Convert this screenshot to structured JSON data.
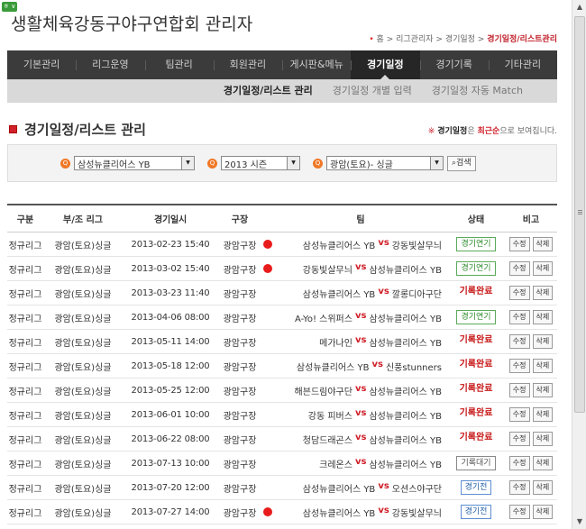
{
  "badge": "ㅎ ∨",
  "site_title": "생활체육강동구야구연합회 관리자",
  "breadcrumb": {
    "home": "홈",
    "path": "리그관리자 > 경기일정 >",
    "current": "경기일정/리스트관리"
  },
  "gnb": [
    {
      "label": "기본관리",
      "active": false
    },
    {
      "label": "리그운영",
      "active": false
    },
    {
      "label": "팀관리",
      "active": false
    },
    {
      "label": "회원관리",
      "active": false
    },
    {
      "label": "게시판&메뉴",
      "active": false
    },
    {
      "label": "경기일정",
      "active": true
    },
    {
      "label": "경기기록",
      "active": false
    },
    {
      "label": "기타관리",
      "active": false
    }
  ],
  "lnb": [
    {
      "label": "경기일정/리스트 관리",
      "active": true
    },
    {
      "label": "경기일정 개별 입력",
      "active": false
    },
    {
      "label": "경기일정 자동 Match",
      "active": false
    }
  ],
  "page_title": "경기일정/리스트 관리",
  "notice": {
    "mark": "※",
    "bold": "경기일정",
    "text1": "은",
    "red": "최근순",
    "text2": "으로 보여집니다."
  },
  "filter": {
    "team": "삼성뉴클리어스 YB",
    "season": "2013 시즌",
    "league": "광암(토요)- 싱글",
    "search_label": "검색"
  },
  "table": {
    "headers": [
      "구분",
      "부/조 리그",
      "경기일시",
      "구장",
      "팀",
      "상태",
      "비고"
    ],
    "edit_label": "수정",
    "delete_label": "삭제",
    "rows": [
      {
        "gubun": "정규리그",
        "league": "광암(토요)싱글",
        "date": "2013-02-23  15:40",
        "field": "광암구장",
        "dot": true,
        "home": "삼성뉴클리어스 YB",
        "vs": "vs",
        "away": "강동빛살무늬",
        "status": "경기연기",
        "status_type": "green"
      },
      {
        "gubun": "정규리그",
        "league": "광암(토요)싱글",
        "date": "2013-03-02  15:40",
        "field": "광암구장",
        "dot": true,
        "home": "강동빛살무늬",
        "vs": "vs",
        "away": "삼성뉴클리어스 YB",
        "status": "경기연기",
        "status_type": "green"
      },
      {
        "gubun": "정규리그",
        "league": "광암(토요)싱글",
        "date": "2013-03-23  11:40",
        "field": "광암구장",
        "dot": false,
        "home": "삼성뉴클리어스 YB",
        "vs": "vs",
        "away": "깔롱디아구단",
        "status": "기록완료",
        "status_type": "red"
      },
      {
        "gubun": "정규리그",
        "league": "광암(토요)싱글",
        "date": "2013-04-06  08:00",
        "field": "광암구장",
        "dot": false,
        "home": "A-Yo! 스위퍼스",
        "vs": "vs",
        "away": "삼성뉴클리어스 YB",
        "status": "경기연기",
        "status_type": "green"
      },
      {
        "gubun": "정규리그",
        "league": "광암(토요)싱글",
        "date": "2013-05-11  14:00",
        "field": "광암구장",
        "dot": false,
        "home": "메가나인",
        "vs": "vs",
        "away": "삼성뉴클리어스 YB",
        "status": "기록완료",
        "status_type": "red"
      },
      {
        "gubun": "정규리그",
        "league": "광암(토요)싱글",
        "date": "2013-05-18  12:00",
        "field": "광암구장",
        "dot": false,
        "home": "삼성뉴클리어스 YB",
        "vs": "vs",
        "away": "신풍stunners",
        "status": "기록완료",
        "status_type": "red"
      },
      {
        "gubun": "정규리그",
        "league": "광암(토요)싱글",
        "date": "2013-05-25  12:00",
        "field": "광암구장",
        "dot": false,
        "home": "해븐드림야구단",
        "vs": "vs",
        "away": "삼성뉴클리어스 YB",
        "status": "기록완료",
        "status_type": "red"
      },
      {
        "gubun": "정규리그",
        "league": "광암(토요)싱글",
        "date": "2013-06-01  10:00",
        "field": "광암구장",
        "dot": false,
        "home": "강동 피버스",
        "vs": "vs",
        "away": "삼성뉴클리어스 YB",
        "status": "기록완료",
        "status_type": "red"
      },
      {
        "gubun": "정규리그",
        "league": "광암(토요)싱글",
        "date": "2013-06-22  08:00",
        "field": "광암구장",
        "dot": false,
        "home": "청담드래곤스",
        "vs": "vs",
        "away": "삼성뉴클리어스 YB",
        "status": "기록완료",
        "status_type": "red"
      },
      {
        "gubun": "정규리그",
        "league": "광암(토요)싱글",
        "date": "2013-07-13  10:00",
        "field": "광암구장",
        "dot": false,
        "home": "크레온스",
        "vs": "vs",
        "away": "삼성뉴클리어스 YB",
        "status": "기록대기",
        "status_type": "gray"
      },
      {
        "gubun": "정규리그",
        "league": "광암(토요)싱글",
        "date": "2013-07-20  12:00",
        "field": "광암구장",
        "dot": false,
        "home": "삼성뉴클리어스 YB",
        "vs": "vs",
        "away": "오션스야구단",
        "status": "경기전",
        "status_type": "blue"
      },
      {
        "gubun": "정규리그",
        "league": "광암(토요)싱글",
        "date": "2013-07-27  14:00",
        "field": "광암구장",
        "dot": true,
        "home": "삼성뉴클리어스 YB",
        "vs": "vs",
        "away": "강동빛살무늬",
        "status": "경기전",
        "status_type": "blue"
      }
    ]
  }
}
